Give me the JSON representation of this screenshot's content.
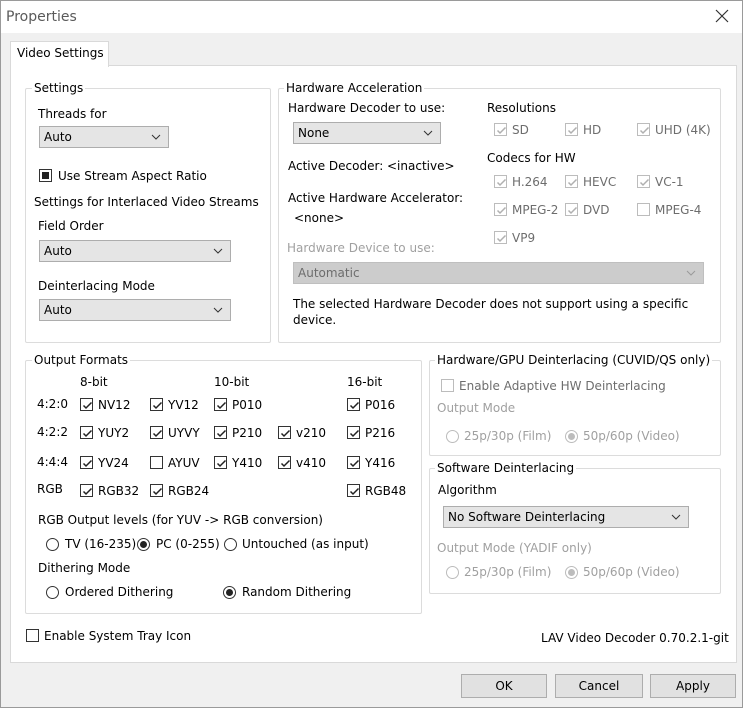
{
  "window": {
    "title": "Properties"
  },
  "tabs": [
    {
      "label": "Video Settings"
    }
  ],
  "settings": {
    "group_label": "Settings",
    "threads_label": "Threads for",
    "threads_value": "Auto",
    "stream_aspect_label": "Use Stream Aspect Ratio",
    "interlaced_label": "Settings for Interlaced Video Streams",
    "field_order_label": "Field Order",
    "field_order_value": "Auto",
    "deint_mode_label": "Deinterlacing Mode",
    "deint_mode_value": "Auto"
  },
  "hw": {
    "group_label": "Hardware Acceleration",
    "decoder_label": "Hardware Decoder to use:",
    "decoder_value": "None",
    "active_decoder_label": "Active Decoder:",
    "active_decoder_value": "<inactive>",
    "active_accel_label": "Active Hardware Accelerator:",
    "active_accel_value": "<none>",
    "device_label": "Hardware Device to use:",
    "device_value": "Automatic",
    "note": "The selected Hardware Decoder does not support using a specific",
    "note2": "device.",
    "resolutions_label": "Resolutions",
    "res": [
      "SD",
      "HD",
      "UHD (4K)"
    ],
    "codecs_label": "Codecs for HW",
    "codecs": [
      "H.264",
      "HEVC",
      "VC-1",
      "MPEG-2",
      "DVD",
      "MPEG-4",
      "VP9"
    ]
  },
  "output": {
    "group_label": "Output Formats",
    "col_headers": [
      "8-bit",
      "10-bit",
      "16-bit"
    ],
    "rows": [
      "4:2:0",
      "4:2:2",
      "4:4:4",
      "RGB"
    ],
    "formats": [
      "NV12",
      "YV12",
      "P010",
      "P016",
      "YUY2",
      "UYVY",
      "P210",
      "v210",
      "P216",
      "YV24",
      "AYUV",
      "Y410",
      "v410",
      "Y416",
      "RGB32",
      "RGB24",
      "RGB48"
    ],
    "levels_label": "RGB Output levels (for YUV -> RGB conversion)",
    "levels": [
      "TV (16-235)",
      "PC (0-255)",
      "Untouched (as input)"
    ],
    "dither_label": "Dithering Mode",
    "dither": [
      "Ordered Dithering",
      "Random Dithering"
    ]
  },
  "hw_deint": {
    "group_label": "Hardware/GPU Deinterlacing (CUVID/QS only)",
    "enable_label": "Enable Adaptive HW Deinterlacing",
    "output_mode_label": "Output Mode",
    "mode1": "25p/30p (Film)",
    "mode2": "50p/60p (Video)"
  },
  "sw_deint": {
    "group_label": "Software Deinterlacing",
    "algorithm_label": "Algorithm",
    "algorithm_value": "No Software Deinterlacing",
    "output_mode_label": "Output Mode (YADIF only)",
    "mode1": "25p/30p (Film)",
    "mode2": "50p/60p (Video)"
  },
  "tray_label": "Enable System Tray Icon",
  "version": "LAV Video Decoder 0.70.2.1-git",
  "buttons": {
    "ok": "OK",
    "cancel": "Cancel",
    "apply": "Apply"
  }
}
